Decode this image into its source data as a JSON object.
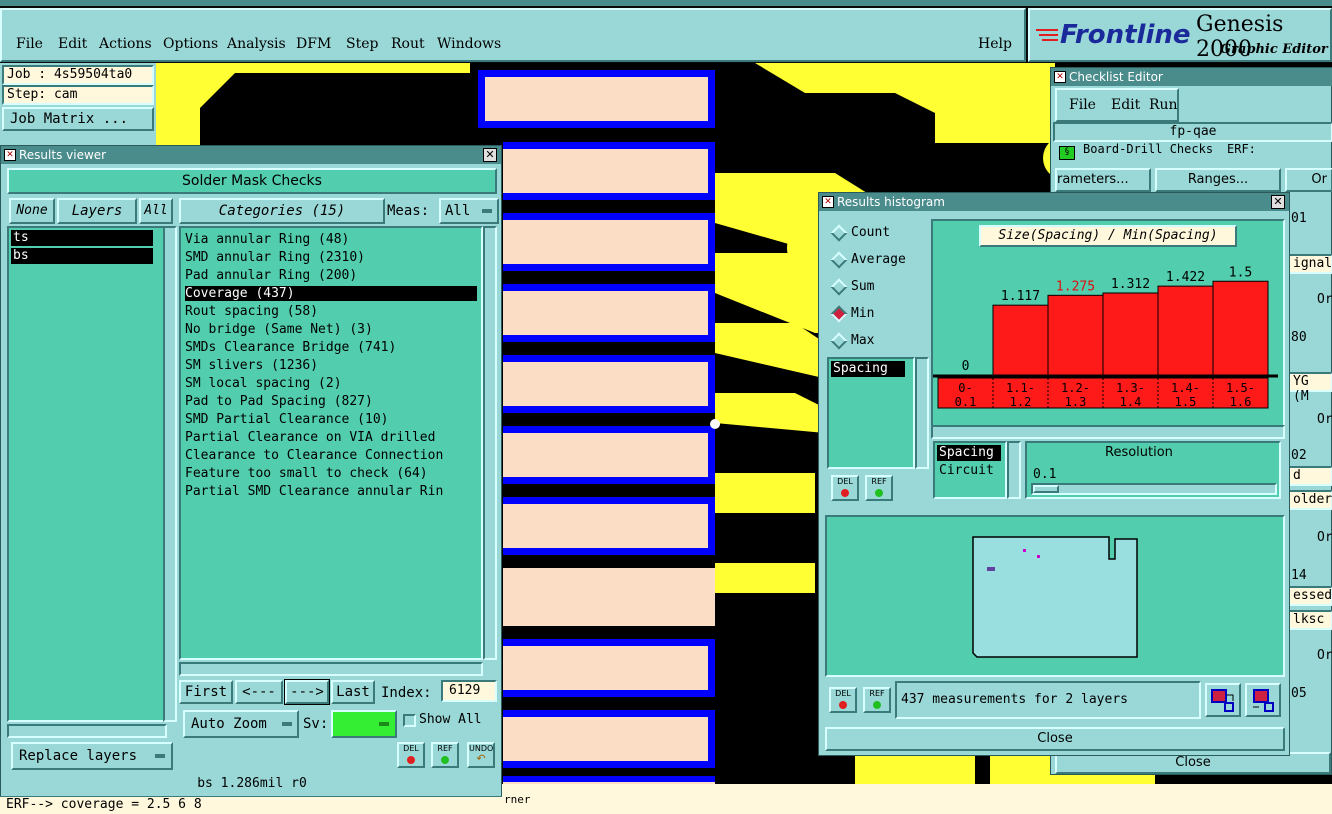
{
  "window": {
    "title": "Graphic Editor Genesis 2000 — Windows, pl..."
  },
  "menu": {
    "file": "File",
    "edit": "Edit",
    "actions": "Actions",
    "options": "Options",
    "analysis": "Analysis",
    "dfm": "DFM",
    "step": "Step",
    "rout": "Rout",
    "windows": "Windows",
    "help": "Help"
  },
  "brand": {
    "name": "Frontline",
    "product": "Genesis 2000",
    "subtitle": "Graphic Editor"
  },
  "job": {
    "job": "Job : 4s59504ta0",
    "step": "Step: cam",
    "matrix": "Job Matrix ..."
  },
  "results_viewer": {
    "title": "Results viewer",
    "header": "Solder Mask Checks",
    "none": "None",
    "layers": "Layers",
    "all": "All",
    "categories_btn": "Categories (15)",
    "meas_label": "Meas:",
    "meas_value": "All",
    "layer_items": [
      "ts",
      "bs"
    ],
    "categories": [
      "Via annular Ring (48)",
      "SMD annular Ring (2310)",
      "Pad annular Ring (200)",
      "Coverage (437)",
      "Rout spacing (58)",
      "No bridge (Same Net) (3)",
      "SMDs Clearance Bridge (741)",
      "SM slivers (1236)",
      "SM local spacing (2)",
      "Pad to Pad Spacing (827)",
      "SMD Partial Clearance (10)",
      "Partial Clearance on VIA drilled",
      "Clearance to Clearance Connection",
      "Feature too small to check (64)",
      "Partial SMD Clearance annular Rin"
    ],
    "first": "First",
    "prev": "<---",
    "next": "--->",
    "last": "Last",
    "index_label": "Index:",
    "index_value": "6129",
    "auto_zoom": "Auto Zoom",
    "sv_label": "Sv:",
    "show_all": "Show All",
    "replace_layers": "Replace layers",
    "del": "DEL",
    "ref": "REF",
    "undo": "UNDO",
    "status": "bs 1.286mil  r0",
    "erf_line": "ERF--> coverage = 2.5 6 8",
    "corner_fragment": "rner"
  },
  "checklist": {
    "title": "Checklist Editor",
    "file": "File",
    "edit": "Edit",
    "run": "Run",
    "name": "fp-qae",
    "row1": "Board-Drill Checks",
    "erf": "ERF:",
    "params": "rameters...",
    "ranges": "Ranges...",
    "or": "Or",
    "frag": [
      "01",
      "ignal",
      "Or",
      "80",
      "YG (M",
      "Or",
      "02",
      "d",
      "older",
      "Or",
      "14",
      "essed",
      "lksc",
      "Or",
      "05"
    ],
    "close": "Close"
  },
  "histogram": {
    "title": "Results histogram",
    "radios": [
      "Count",
      "Average",
      "Sum",
      "Min",
      "Max"
    ],
    "selected": "Min",
    "chart_title": "Size(Spacing) / Min(Spacing)",
    "list1": [
      "Spacing"
    ],
    "list2": [
      "Spacing",
      "Circuit"
    ],
    "resolution_label": "Resolution",
    "resolution_value": "0.1",
    "summary": "437 measurements for 2 layers",
    "del": "DEL",
    "ref": "REF",
    "close": "Close"
  },
  "chart_data": {
    "type": "bar",
    "title": "Size(Spacing) / Min(Spacing)",
    "categories": [
      "0-\n0.1",
      "1.1-\n1.2",
      "1.2-\n1.3",
      "1.3-\n1.4",
      "1.4-\n1.5",
      "1.5-\n1.6"
    ],
    "category_labels_top": [
      "0-",
      "1.1-",
      "1.2-",
      "1.3-",
      "1.4-",
      "1.5-"
    ],
    "category_labels_bottom": [
      "0.1",
      "1.2",
      "1.3",
      "1.4",
      "1.5",
      "1.6"
    ],
    "values": [
      0,
      1.117,
      1.275,
      1.312,
      1.422,
      1.5
    ],
    "value_labels": [
      "0",
      "1.117",
      "1.275",
      "1.312",
      "1.422",
      "1.5"
    ],
    "highlight_index": 2,
    "bar_color": "#ff1a1a",
    "highlight_color": "#ff1a1a",
    "ylim": [
      0,
      1.6
    ]
  },
  "colors": {
    "panel": "#52cdad",
    "chrome": "#9ad8d8",
    "copper": "#ffff33",
    "mask": "#0000ff",
    "pad": "#fbdcc4"
  }
}
